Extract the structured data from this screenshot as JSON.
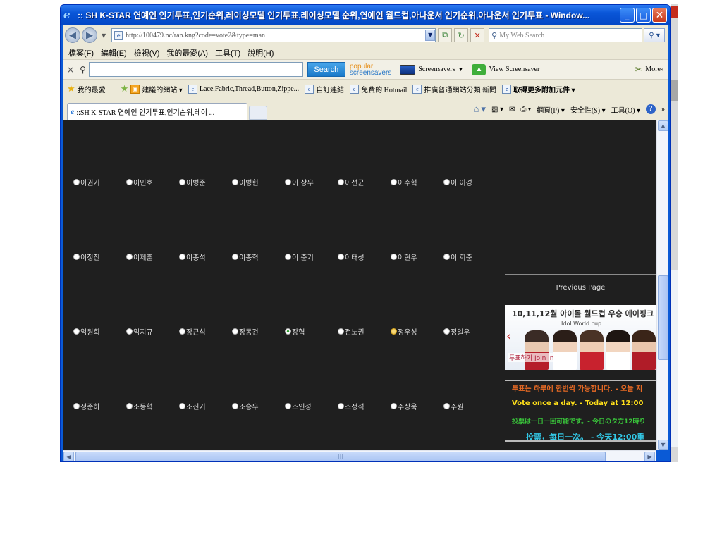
{
  "window": {
    "title": ":: SH K-STAR 연예인 인기투표,인기순위,레이싱모델 인기투표,레이싱모델 순위,연예인 월드컵,아나운서 인기순위,아나운서 인기투표 - Window..."
  },
  "address_bar": {
    "url": "http://100479.nc/ran.kng?code=vote2&type=man",
    "search_placeholder": "My Web Search"
  },
  "menu": [
    "檔案(F)",
    "編輯(E)",
    "檢視(V)",
    "我的最愛(A)",
    "工具(T)",
    "說明(H)"
  ],
  "toolbar": {
    "close": "×",
    "search_button": "Search",
    "popular_line1": "popular",
    "popular_line2": "screensavers",
    "screensavers": "Screensavers",
    "view_screensaver": "View Screensaver",
    "more": "More"
  },
  "favorites": {
    "label": "我的最愛",
    "items": [
      "建議的網站 ▾",
      "Lace,Fabric,Thread,Button,Zippe...",
      "自訂連結",
      "免費的 Hotmail",
      "推廣普通網站分類 新聞",
      "取得更多附加元件 ▾"
    ]
  },
  "tab": {
    "title": "::SH K-STAR 연예인 인기투표,인기순위,레이 ..."
  },
  "command_bar": {
    "page": "網頁(P) ▾",
    "safety": "安全性(S) ▾",
    "tools": "工具(O) ▾"
  },
  "candidates": {
    "rows": [
      [
        {
          "name": "이권기",
          "state": "normal"
        },
        {
          "name": "이민호",
          "state": "normal"
        },
        {
          "name": "이병준",
          "state": "normal"
        },
        {
          "name": "이병헌",
          "state": "normal"
        },
        {
          "name": "이 상우",
          "state": "normal"
        },
        {
          "name": "이선균",
          "state": "normal"
        },
        {
          "name": "이수혁",
          "state": "normal"
        },
        {
          "name": "이 이경",
          "state": "normal"
        }
      ],
      [
        {
          "name": "이정진",
          "state": "normal"
        },
        {
          "name": "이제훈",
          "state": "normal"
        },
        {
          "name": "이종석",
          "state": "normal"
        },
        {
          "name": "이종혁",
          "state": "normal"
        },
        {
          "name": "이 준기",
          "state": "normal"
        },
        {
          "name": "이태성",
          "state": "normal"
        },
        {
          "name": "이현우",
          "state": "normal"
        },
        {
          "name": "이 희준",
          "state": "normal"
        }
      ],
      [
        {
          "name": "임원희",
          "state": "normal"
        },
        {
          "name": "임지규",
          "state": "normal"
        },
        {
          "name": "장근석",
          "state": "normal"
        },
        {
          "name": "장동건",
          "state": "normal"
        },
        {
          "name": "장혁",
          "state": "checked"
        },
        {
          "name": "전노권",
          "state": "normal"
        },
        {
          "name": "정우성",
          "state": "hover"
        },
        {
          "name": "정일우",
          "state": "normal"
        }
      ],
      [
        {
          "name": "정준하",
          "state": "normal"
        },
        {
          "name": "조동혁",
          "state": "normal"
        },
        {
          "name": "조진기",
          "state": "normal"
        },
        {
          "name": "조승우",
          "state": "normal"
        },
        {
          "name": "조인성",
          "state": "normal"
        },
        {
          "name": "조정석",
          "state": "normal"
        },
        {
          "name": "주상욱",
          "state": "normal"
        },
        {
          "name": "주원",
          "state": "normal"
        }
      ]
    ]
  },
  "sidebar": {
    "previous_page": "Previous Page",
    "banner_title": "10,11,12월 아이돌 월드컵 우승 에이핑크",
    "banner_sub": "Idol World cup",
    "banner_cta": "투표하기 Join in",
    "notice_ko": "투표는 하루에 한번씩 가능합니다. - 오늘 지",
    "notice_en": "Vote once a day. - Today at 12:00",
    "notice_ja": "投票は一日一回可能です。- 今日のタ方12時り",
    "notice_zh": "投票，每日一次。 - 今天12:00重"
  },
  "colors": {
    "content_bg": "#1f1f1f",
    "title_bar": "#0a56d8",
    "notice_orange": "#e86a24",
    "notice_yellow": "#ffe01a",
    "notice_green": "#39c43a",
    "notice_cyan": "#33c8e6"
  }
}
